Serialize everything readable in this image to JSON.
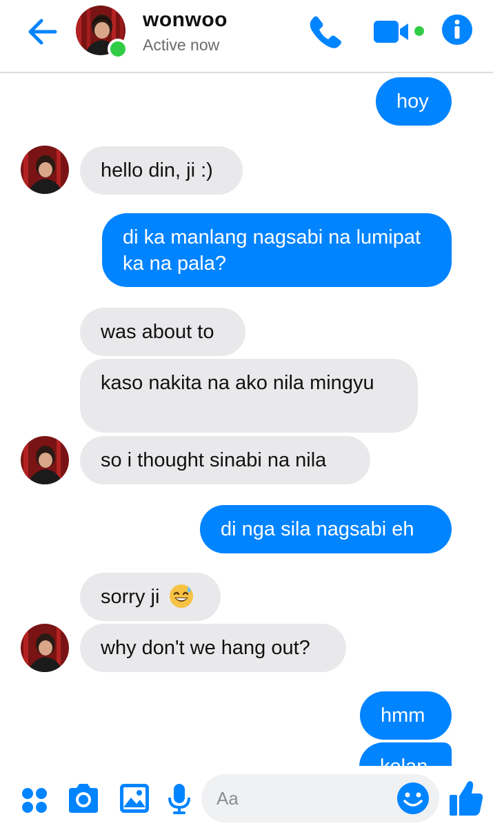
{
  "header": {
    "name": "wonwoo",
    "status": "Active now"
  },
  "messages": [
    {
      "side": "out",
      "text": "hoy"
    },
    {
      "side": "in",
      "text": "hello din, ji :)"
    },
    {
      "side": "out",
      "text": "di ka manlang nagsabi na lumipat ka na pala?"
    },
    {
      "side": "in",
      "text": "was about to"
    },
    {
      "side": "in",
      "text": "kaso nakita na ako nila mingyu"
    },
    {
      "side": "in",
      "text": "so i thought sinabi na nila"
    },
    {
      "side": "out",
      "text": "di nga sila nagsabi eh"
    },
    {
      "side": "in",
      "text": "sorry ji",
      "emoji": "grinning-sweat-emoji"
    },
    {
      "side": "in",
      "text": "why don't we hang out?"
    },
    {
      "side": "out",
      "text": "hmm"
    },
    {
      "side": "out",
      "text": "kelan"
    }
  ],
  "composer": {
    "placeholder": "Aa"
  },
  "colors": {
    "accent": "#0084ff",
    "incoming_bubble": "#e9e9eb",
    "online": "#31cc46"
  },
  "icons": [
    "back-arrow-icon",
    "phone-icon",
    "video-camera-icon",
    "info-icon",
    "apps-grid-icon",
    "camera-icon",
    "image-icon",
    "microphone-icon",
    "emoji-icon",
    "thumbs-up-icon"
  ]
}
